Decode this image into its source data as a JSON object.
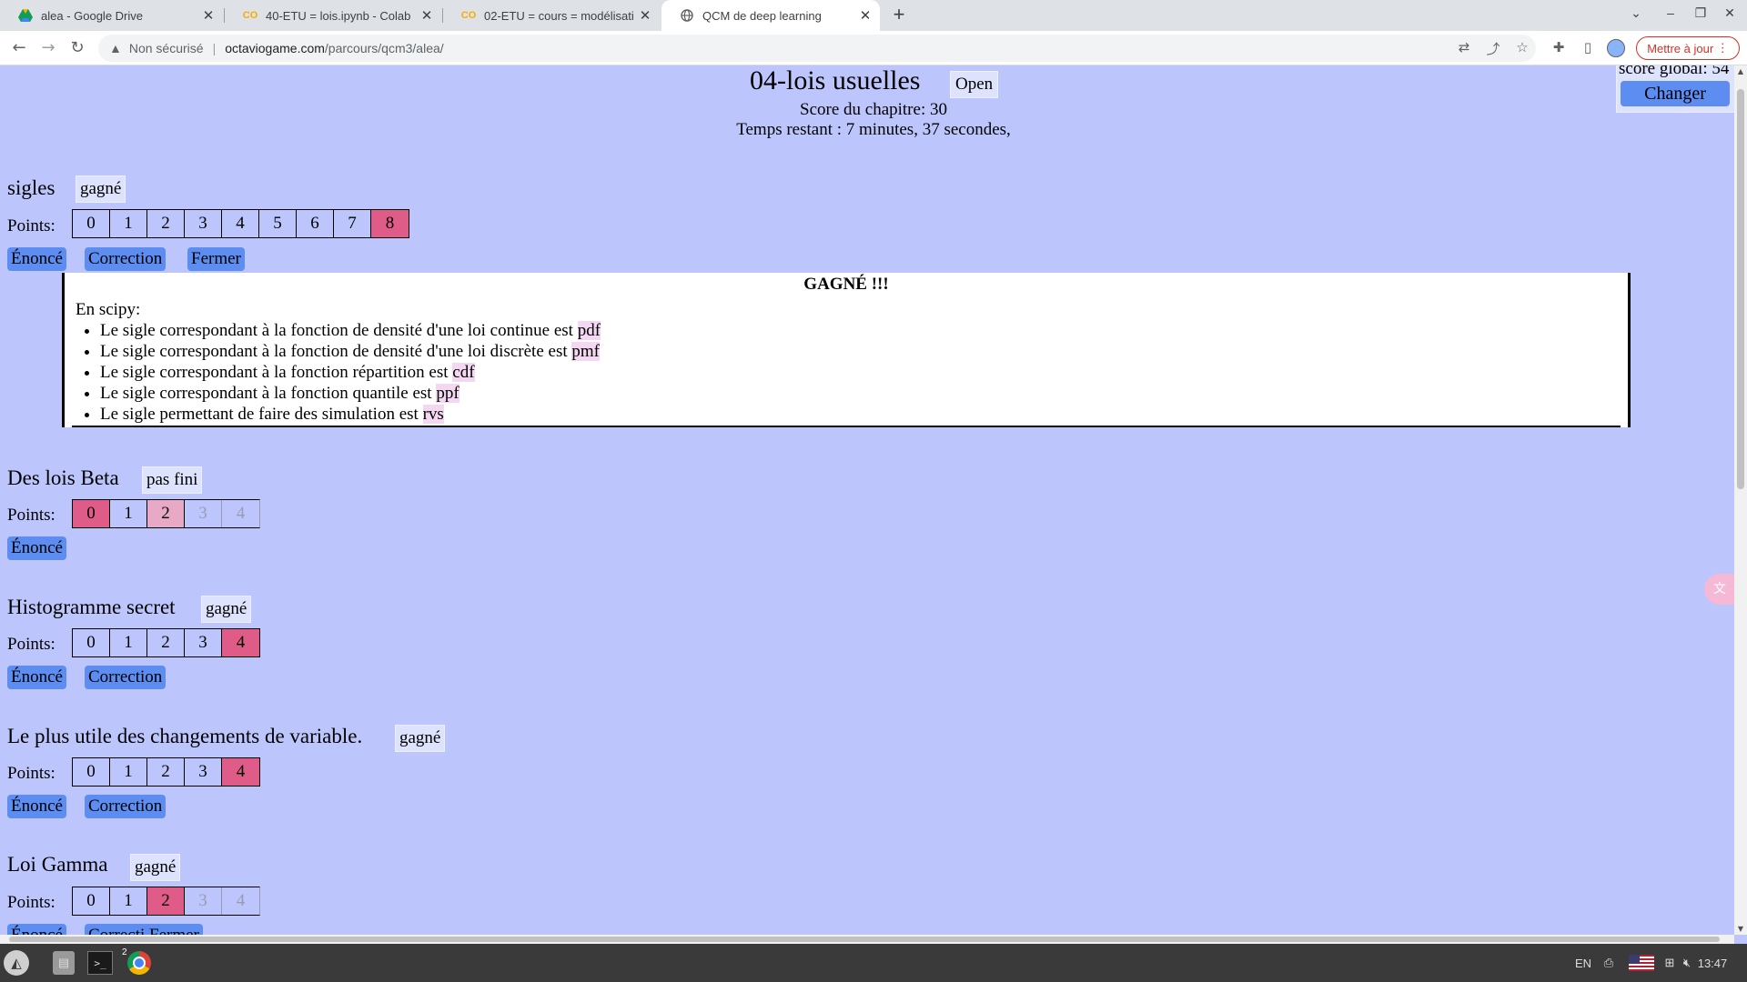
{
  "browser": {
    "tabs": [
      {
        "title": "alea - Google Drive",
        "icon": "google-drive-icon",
        "active": false
      },
      {
        "title": "40-ETU = lois.ipynb - Colab",
        "icon": "colab-icon",
        "active": false
      },
      {
        "title": "02-ETU = cours = modélisation",
        "icon": "colab-icon",
        "active": false
      },
      {
        "title": "QCM de deep learning",
        "icon": "globe-icon",
        "active": true
      }
    ],
    "security_label": "Non sécurisé",
    "url_domain": "octaviogame.com",
    "url_path": "/parcours/qcm3/alea/",
    "update_button": "Mettre à jour"
  },
  "header": {
    "chapter_title": "04-lois usuelles",
    "open_button": "Open",
    "chapter_score": "Score du chapitre: 30",
    "time_remaining": "Temps restant : 7 minutes, 37 secondes,",
    "global_score_label": "score global: 54",
    "change_button": "Changer"
  },
  "points_label": "Points:",
  "buttons": {
    "enonce": "Énoncé",
    "correction": "Correction",
    "fermer": "Fermer"
  },
  "exercises": [
    {
      "title": "sigles",
      "status": "gagné",
      "points": [
        "0",
        "1",
        "2",
        "3",
        "4",
        "5",
        "6",
        "7",
        "8"
      ],
      "selected_point": 8
    },
    {
      "title": "Des lois Beta",
      "status": "pas fini",
      "points": [
        "0",
        "1",
        "2",
        "3",
        "4"
      ],
      "selected_point": 0,
      "partial_point": 2,
      "disabled_from": 3
    },
    {
      "title": "Histogramme secret",
      "status": "gagné",
      "points": [
        "0",
        "1",
        "2",
        "3",
        "4"
      ],
      "selected_point": 4
    },
    {
      "title": "Le plus utile des changements de variable.",
      "status": "gagné",
      "points": [
        "0",
        "1",
        "2",
        "3",
        "4"
      ],
      "selected_point": 4
    },
    {
      "title": "Loi Gamma",
      "status": "gagné",
      "points": [
        "0",
        "1",
        "2",
        "3",
        "4"
      ],
      "selected_point": 2,
      "disabled_from": 3
    }
  ],
  "correction": {
    "title": "GAGNÉ !!!",
    "intro": "En scipy:",
    "items": [
      {
        "text": "Le sigle correspondant à la fonction de densité d'une loi continue est ",
        "code": "pdf"
      },
      {
        "text": "Le sigle correspondant à la fonction de densité d'une loi discrète est ",
        "code": "pmf"
      },
      {
        "text": "Le sigle correspondant à la fonction répartition est ",
        "code": "cdf"
      },
      {
        "text": "Le sigle correspondant à la fonction quantile est ",
        "code": "ppf"
      },
      {
        "text": "Le sigle permettant de faire des simulation est ",
        "code": "rvs"
      }
    ]
  },
  "taskbar": {
    "chrome_badge": "2",
    "language": "EN",
    "clock": "13:47"
  },
  "colors": {
    "page_background": "#bcc6fc",
    "button_blue": "#5d8df0",
    "selected_point": "#e05c88",
    "partial_point": "#e8a9c6"
  }
}
